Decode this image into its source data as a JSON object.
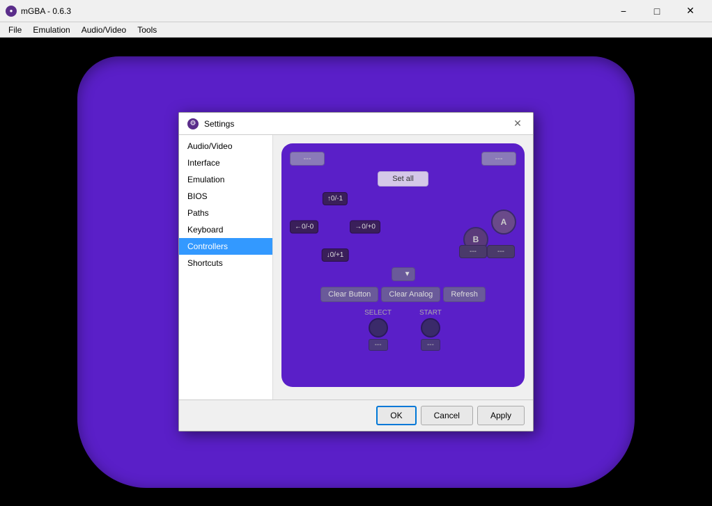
{
  "titlebar": {
    "icon": "●",
    "title": "mGBA - 0.6.3",
    "minimize": "−",
    "maximize": "□",
    "close": "✕"
  },
  "menubar": {
    "items": [
      "File",
      "Emulation",
      "Audio/Video",
      "Tools"
    ]
  },
  "dialog": {
    "title": "Settings",
    "close": "✕",
    "sidebar": {
      "items": [
        {
          "id": "audio-video",
          "label": "Audio/Video"
        },
        {
          "id": "interface",
          "label": "Interface"
        },
        {
          "id": "emulation",
          "label": "Emulation"
        },
        {
          "id": "bios",
          "label": "BIOS"
        },
        {
          "id": "paths",
          "label": "Paths"
        },
        {
          "id": "keyboard",
          "label": "Keyboard"
        },
        {
          "id": "controllers",
          "label": "Controllers",
          "active": true
        },
        {
          "id": "shortcuts",
          "label": "Shortcuts"
        }
      ]
    },
    "controller": {
      "top_left_btn": "---",
      "top_right_btn": "---",
      "set_all_label": "Set all",
      "dpad": {
        "up": "↑0/-1",
        "down": "↓0/+1",
        "left": "←0/-0",
        "right": "→0/+0"
      },
      "face_btns": {
        "a_label": "A",
        "b_label": "B",
        "a_mapping": "---",
        "b_mapping": "---"
      },
      "dropdown_placeholder": "",
      "clear_button_label": "Clear Button",
      "clear_analog_label": "Clear Analog",
      "refresh_label": "Refresh",
      "select_label": "SELECT",
      "start_label": "START",
      "select_mapping": "---",
      "start_mapping": "---"
    },
    "footer": {
      "ok": "OK",
      "cancel": "Cancel",
      "apply": "Apply"
    }
  }
}
